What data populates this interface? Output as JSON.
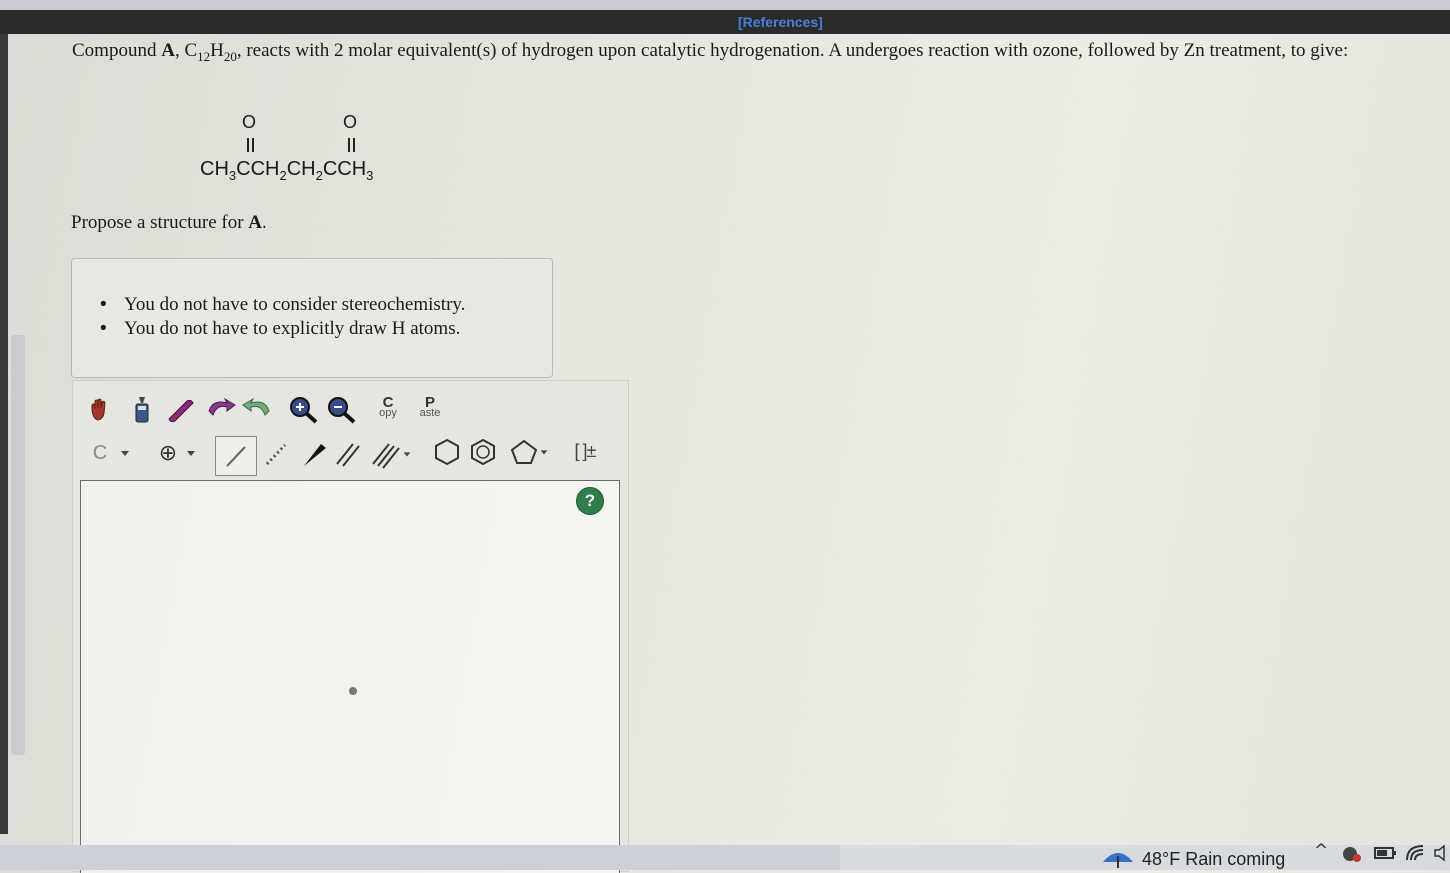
{
  "header": {
    "references_label": "[References]"
  },
  "question": {
    "intro_1": "Compound ",
    "compound": "A",
    "intro_2": ", C",
    "sub_c": "12",
    "h": "H",
    "sub_h": "20",
    "intro_3": ", reacts with 2 molar equivalent(s) of hydrogen upon catalytic hydrogenation. A undergoes reaction with ozone, followed by Zn treatment, to give:",
    "product": {
      "oxygen": "O",
      "formula_parts": [
        "CH",
        "3",
        "CCH",
        "2",
        "CH",
        "2",
        "CCH",
        "3"
      ]
    },
    "prompt_1": "Propose a structure for ",
    "prompt_compound": "A",
    "prompt_2": "."
  },
  "hints": [
    "You do not have to consider stereochemistry.",
    "You do not have to explicitly draw H atoms."
  ],
  "toolbar": {
    "copy_top": "C",
    "copy_bottom": "opy",
    "paste_top": "P",
    "paste_bottom": "aste",
    "atom_label": "C",
    "charge_label": "⊕",
    "bracket_label": "[ ]±"
  },
  "help_label": "?",
  "taskbar": {
    "weather": "48°F  Rain coming"
  },
  "colors": {
    "help_green": "#2e7d4b",
    "references_blue": "#4a7fd8"
  }
}
